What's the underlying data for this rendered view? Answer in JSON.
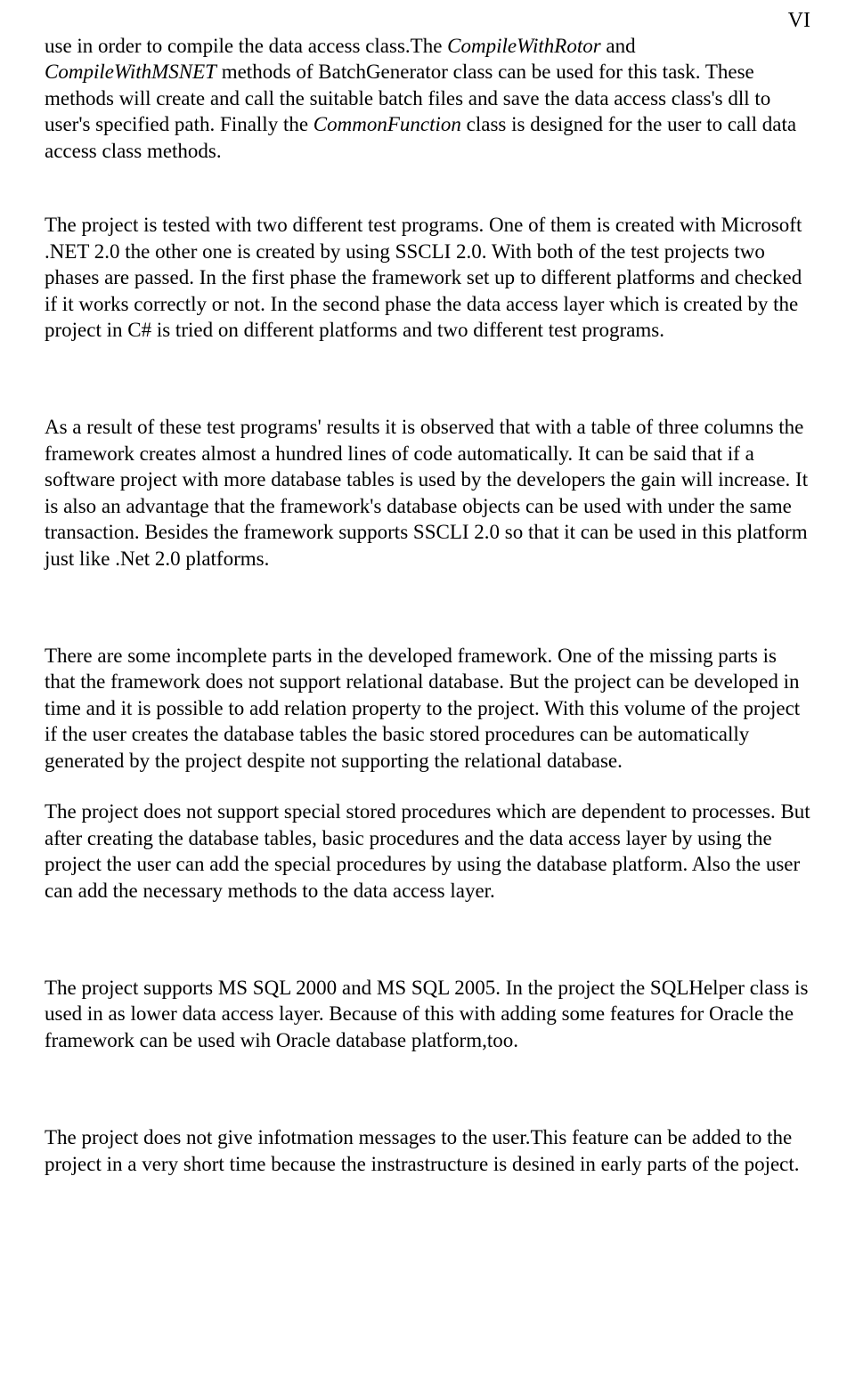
{
  "header": {
    "page_number": "VI"
  },
  "body": {
    "p1": {
      "seg1": "use in order to compile the data access class.The ",
      "italic1": "CompileWithRotor",
      "seg2": " and ",
      "italic2": "CompileWithMSNET",
      "seg3": " methods of BatchGenerator class can be used for this task. These methods will create and call the suitable batch files and save the data access class's dll to user's specified path. Finally the ",
      "italic3": "CommonFunction",
      "seg4": " class is designed for the user to call data access class methods."
    },
    "p2": "The project is tested with two different test programs. One of them is created with Microsoft .NET 2.0 the other one is created by using SSCLI 2.0. With both of the test projects two phases are passed. In the first phase the framework set up to different platforms and checked if it works correctly or not. In the second phase the data access layer which is created by the project in C# is tried on different platforms and two different test programs.",
    "p3": "As a result of these test programs' results it is observed that with a table of three columns the framework creates almost a hundred lines of code automatically. It can be said that if a software project with more database tables is used by the developers the gain will increase. It is also an advantage that the framework's database objects can be used with under the same transaction. Besides the framework supports SSCLI 2.0 so that it can be used in this platform just like .Net 2.0 platforms.",
    "p4": "There are some incomplete parts in the developed framework. One of the missing parts is that the framework does not support relational database. But the project can be developed in time and it is possible to add relation property to the project. With this volume of the project if the user creates the database tables the basic stored procedures can be automatically generated by the project despite not supporting the relational database.",
    "p5": "The project does not support special stored procedures which are dependent to processes. But after creating the database tables, basic procedures and the data access layer by using the project the user can add the special procedures by using the database platform. Also the user can add the necessary methods to the data access layer.",
    "p6": "The project supports MS SQL 2000 and MS SQL 2005. In the project the SQLHelper class is used in as lower data access layer. Because of this with adding some features for Oracle the framework can be used wih Oracle database platform,too.",
    "p7": "The project does not give infotmation messages to the user.This feature can be added to the project in a very short time because the instrastructure is desined in early parts of the poject."
  }
}
